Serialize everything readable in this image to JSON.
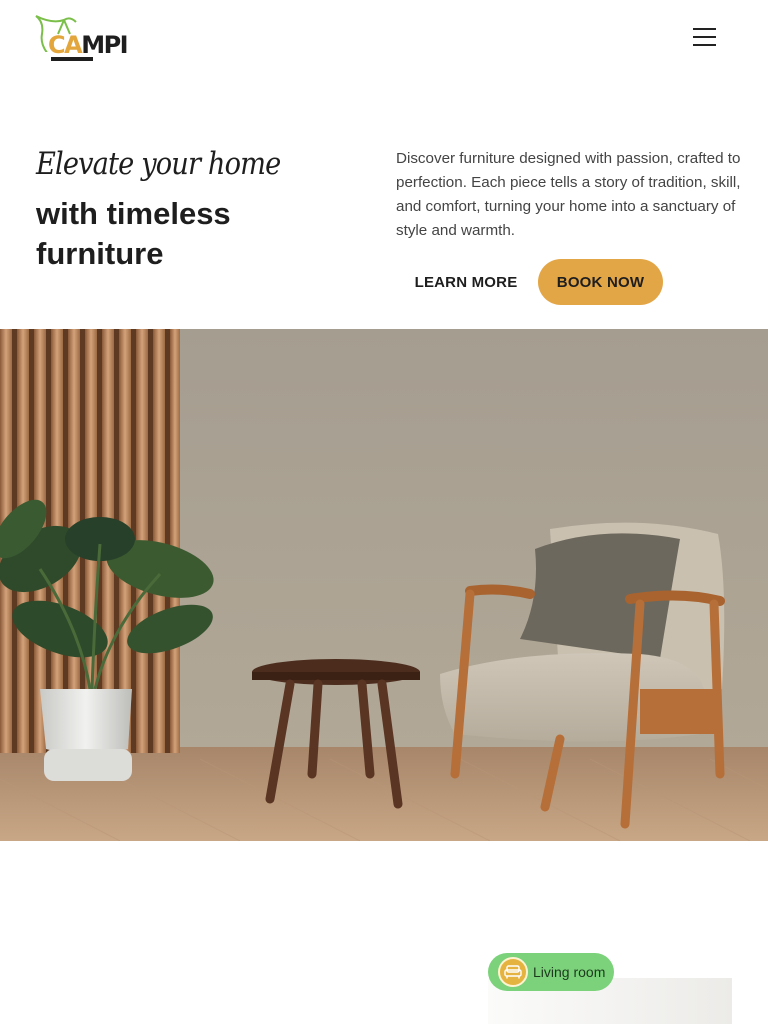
{
  "brand": {
    "logo_ca": "CA",
    "logo_mpi": "MPI",
    "accent": "#e3a646",
    "logo_icon_color": "#7bbf4a"
  },
  "header": {
    "menu_icon": "hamburger-menu-icon"
  },
  "hero": {
    "script_line": "Elevate your home",
    "title": "with timeless furniture",
    "description": "Discover furniture designed with passion, crafted to perfection. Each piece tells a story of tradition, skill, and comfort, turning your home into a sanctuary of style and warmth.",
    "learn_more_label": "LEARN MORE",
    "book_now_label": "BOOK NOW"
  },
  "category_badge": {
    "label": "Living room",
    "icon": "sofa-icon",
    "color": "#7bd27b"
  }
}
